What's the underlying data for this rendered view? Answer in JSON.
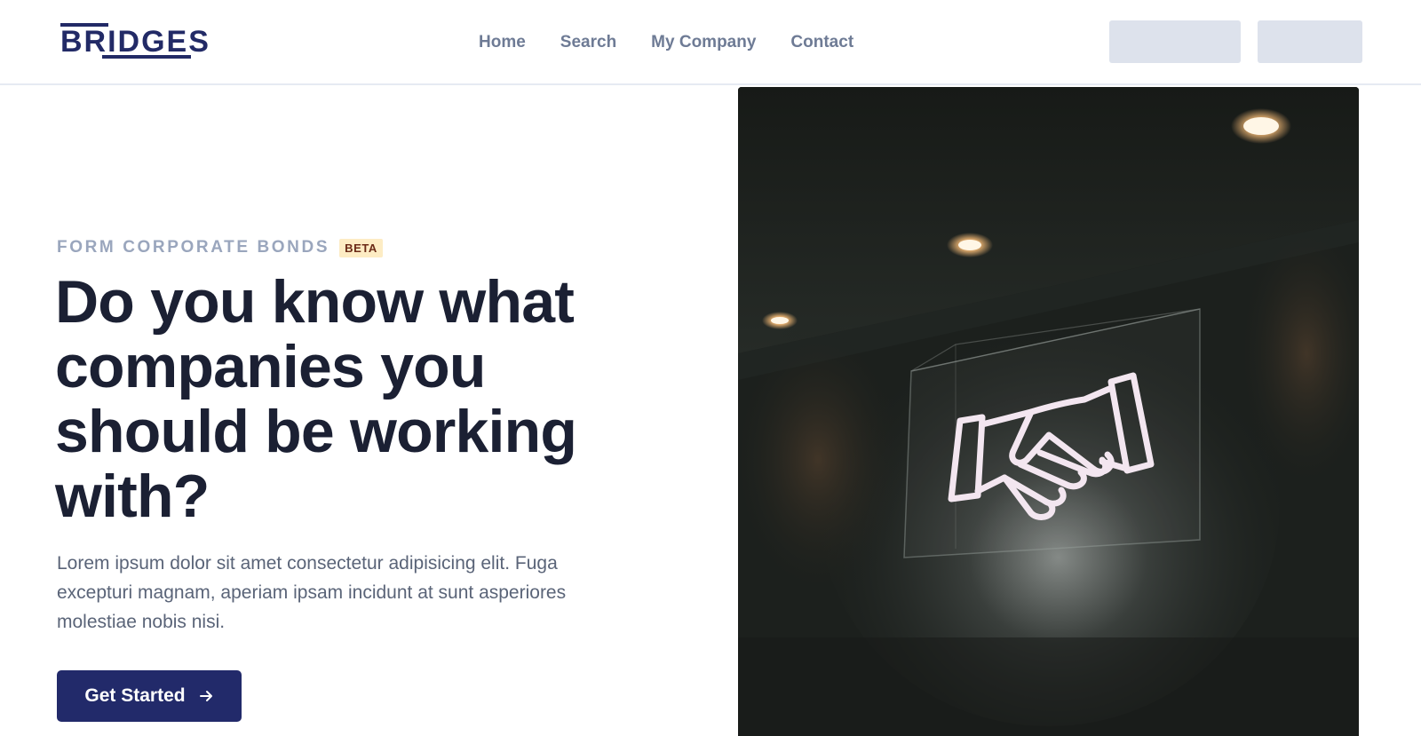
{
  "brand": {
    "name": "BRIDGES"
  },
  "nav": {
    "items": [
      {
        "label": "Home"
      },
      {
        "label": "Search"
      },
      {
        "label": "My Company"
      },
      {
        "label": "Contact"
      }
    ]
  },
  "hero": {
    "eyebrow": "FORM CORPORATE BONDS",
    "badge": "BETA",
    "headline": "Do you know what companies you should be working with?",
    "lead": "Lorem ipsum dolor sit amet consectetur adipisicing elit. Fuga excepturi magnam, aperiam ipsam incidunt at sunt asperiores molestiae nobis nisi.",
    "cta_label": "Get Started",
    "cta_icon": "arrow-right-icon"
  },
  "colors": {
    "brand": "#222a66",
    "cta_bg": "#222a6a",
    "nav_text": "#6e7b95",
    "eyebrow_text": "#9aa6bd",
    "badge_bg": "#fdecc4",
    "badge_text": "#6b2a17",
    "headline": "#1b2033",
    "lead_text": "#5a6478",
    "header_button_bg": "#dde2ec"
  }
}
